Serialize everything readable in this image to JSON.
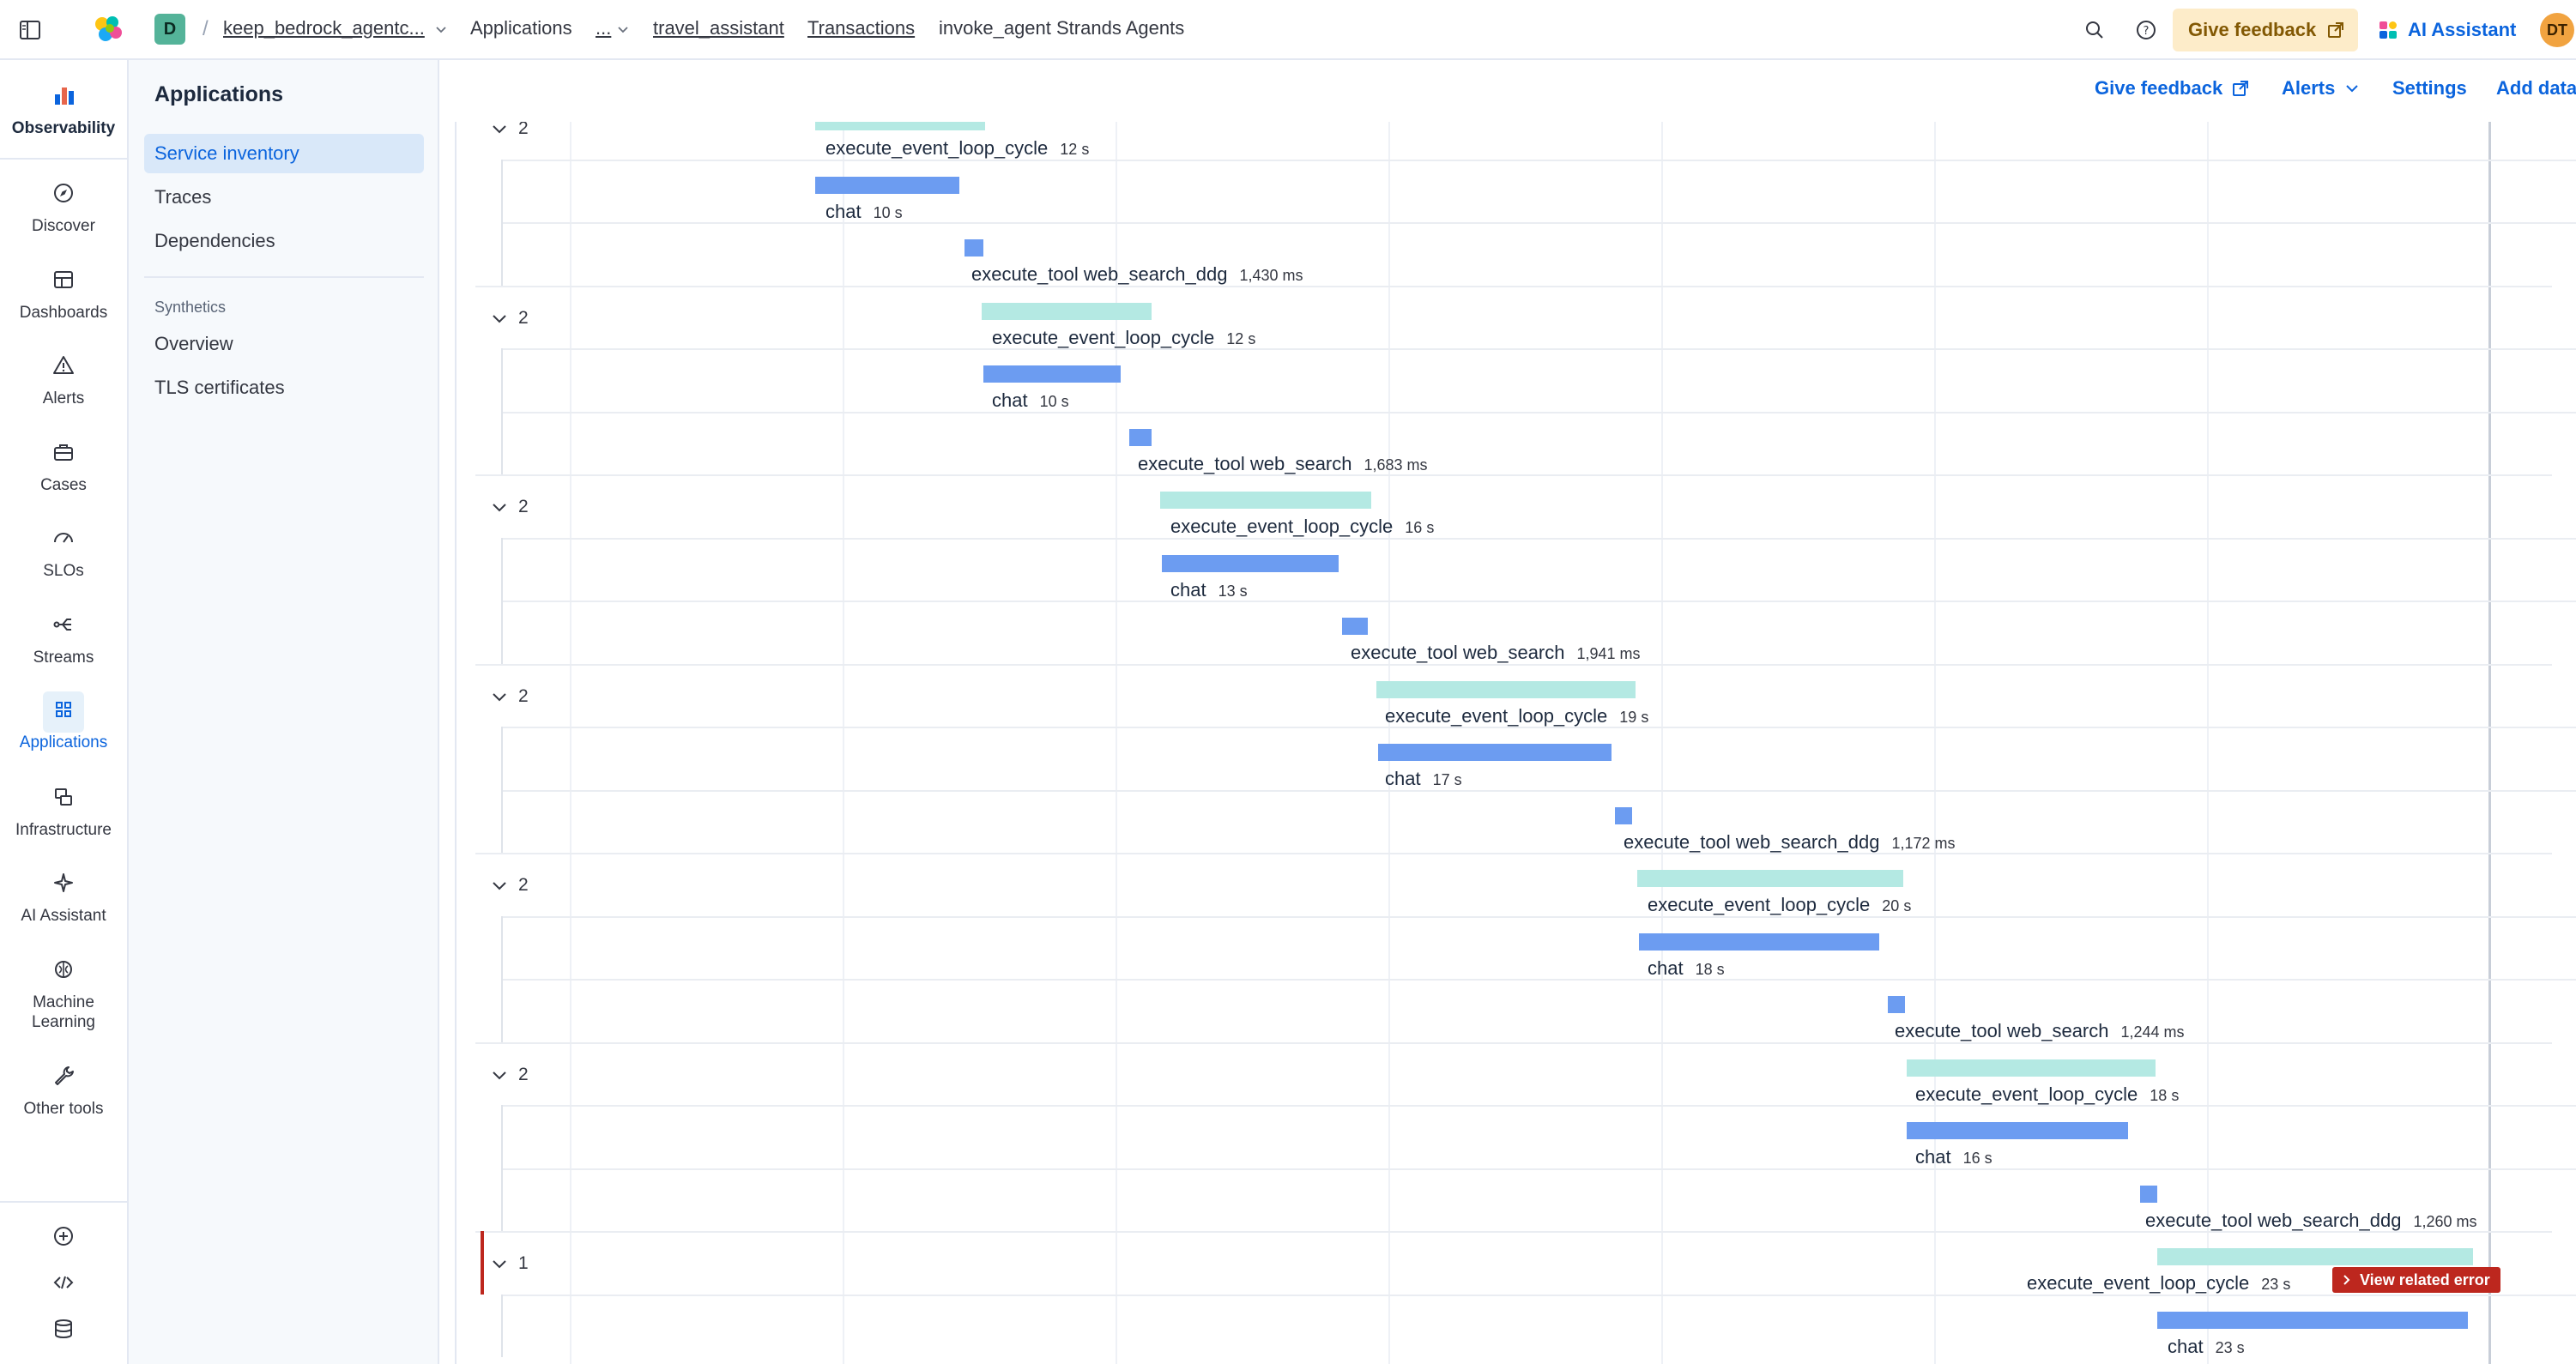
{
  "topbar": {
    "space_initial": "D",
    "breadcrumbs": [
      {
        "label": "keep_bedrock_agentc...",
        "link": true
      },
      {
        "label": "Applications",
        "link": false
      },
      {
        "label": "...",
        "link": true
      },
      {
        "label": "travel_assistant",
        "link": true
      },
      {
        "label": "Transactions",
        "link": true
      },
      {
        "label": "invoke_agent Strands Agents",
        "link": false
      }
    ],
    "give_feedback": "Give feedback",
    "ai_assistant": "AI Assistant",
    "user_initials": "DT"
  },
  "leftnav": {
    "brand": "Observability",
    "items": [
      {
        "label": "Discover",
        "icon": "compass-icon"
      },
      {
        "label": "Dashboards",
        "icon": "dashboard-icon"
      },
      {
        "label": "Alerts",
        "icon": "warning-icon"
      },
      {
        "label": "Cases",
        "icon": "briefcase-icon"
      },
      {
        "label": "SLOs",
        "icon": "gauge-icon"
      },
      {
        "label": "Streams",
        "icon": "streams-icon"
      },
      {
        "label": "Applications",
        "icon": "apps-grid-icon",
        "active": true
      },
      {
        "label": "Infrastructure",
        "icon": "infrastructure-icon"
      },
      {
        "label": "AI Assistant",
        "icon": "sparkles-icon"
      },
      {
        "label": "Machine Learning",
        "icon": "brain-icon"
      },
      {
        "label": "Other tools",
        "icon": "wrench-icon"
      }
    ]
  },
  "subnav": {
    "title": "Applications",
    "items": [
      "Service inventory",
      "Traces",
      "Dependencies"
    ],
    "group_title": "Synthetics",
    "group_items": [
      "Overview",
      "TLS certificates"
    ]
  },
  "actions": {
    "give_feedback": "Give feedback",
    "alerts": "Alerts",
    "settings": "Settings",
    "add_data": "Add data"
  },
  "waterfall": {
    "groups": [
      {
        "count": "2",
        "spans": [
          {
            "name": "execute_event_loop_cycle",
            "duration": "12 s"
          },
          {
            "name": "chat",
            "duration": "10 s"
          },
          {
            "name": "execute_tool web_search_ddg",
            "duration": "1,430 ms"
          }
        ]
      },
      {
        "count": "2",
        "spans": [
          {
            "name": "execute_event_loop_cycle",
            "duration": "12 s"
          },
          {
            "name": "chat",
            "duration": "10 s"
          },
          {
            "name": "execute_tool web_search",
            "duration": "1,683 ms"
          }
        ]
      },
      {
        "count": "2",
        "spans": [
          {
            "name": "execute_event_loop_cycle",
            "duration": "16 s"
          },
          {
            "name": "chat",
            "duration": "13 s"
          },
          {
            "name": "execute_tool web_search",
            "duration": "1,941 ms"
          }
        ]
      },
      {
        "count": "2",
        "spans": [
          {
            "name": "execute_event_loop_cycle",
            "duration": "19 s"
          },
          {
            "name": "chat",
            "duration": "17 s"
          },
          {
            "name": "execute_tool web_search_ddg",
            "duration": "1,172 ms"
          }
        ]
      },
      {
        "count": "2",
        "spans": [
          {
            "name": "execute_event_loop_cycle",
            "duration": "20 s"
          },
          {
            "name": "chat",
            "duration": "18 s"
          },
          {
            "name": "execute_tool web_search",
            "duration": "1,244 ms"
          }
        ]
      },
      {
        "count": "2",
        "spans": [
          {
            "name": "execute_event_loop_cycle",
            "duration": "18 s"
          },
          {
            "name": "chat",
            "duration": "16 s"
          },
          {
            "name": "execute_tool web_search_ddg",
            "duration": "1,260 ms"
          }
        ]
      },
      {
        "count": "1",
        "spans": [
          {
            "name": "execute_event_loop_cycle",
            "duration": "23 s"
          },
          {
            "name": "chat",
            "duration": "23 s"
          }
        ]
      }
    ],
    "error_button": "View related error"
  },
  "colors": {
    "accent": "#0b64dd",
    "cycle_bar": "#b4e9e3",
    "span_bar": "#6c9cf1",
    "error": "#bd271e",
    "feedback_bg": "#fdecc9"
  }
}
